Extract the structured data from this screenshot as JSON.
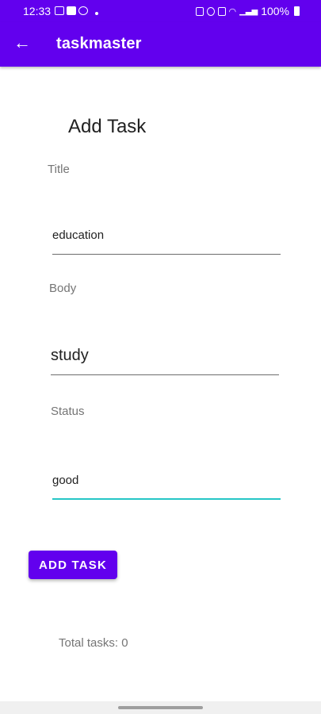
{
  "status_bar": {
    "time": "12:33",
    "battery": "100%",
    "notification_icons": [
      "gallery-icon",
      "youtube-icon",
      "whatsapp-icon"
    ]
  },
  "app_bar": {
    "title": "taskmaster",
    "back_icon": "arrow-left-icon",
    "color": "#6200ee"
  },
  "form": {
    "heading": "Add Task",
    "title_label": "Title",
    "title_value": "education",
    "body_label": "Body",
    "body_value": "study",
    "status_label": "Status",
    "status_value": "good",
    "focus_color": "#26c6c6"
  },
  "actions": {
    "add_task_label": "ADD TASK"
  },
  "footer": {
    "total_tasks": "Total tasks: 0"
  }
}
